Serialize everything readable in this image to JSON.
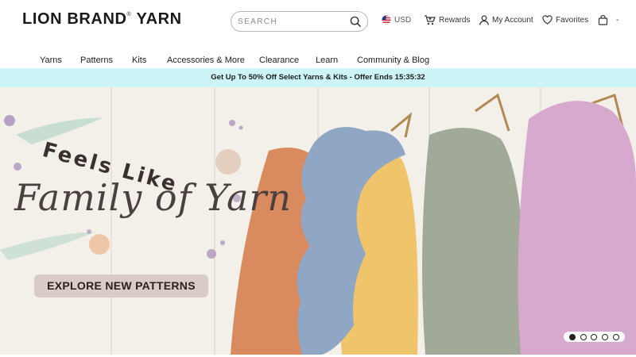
{
  "brand": {
    "name": "LION BRAND",
    "reg": "®",
    "name2": "YARN"
  },
  "search": {
    "placeholder": "SEARCH",
    "icon": "search-icon"
  },
  "utility": {
    "currency": "USD",
    "rewards": "Rewards",
    "account": "My Account",
    "favorites": "Favorites",
    "cart": "-"
  },
  "nav": {
    "items": [
      "Yarns",
      "Patterns",
      "Kits",
      "Accessories & More",
      "Clearance",
      "Learn",
      "Community & Blog"
    ]
  },
  "promo": {
    "text": "Get Up To 50% Off Select Yarns & Kits - Offer Ends 15:35:32"
  },
  "hero": {
    "headline": "Feels Like",
    "script": "Family of Yarn",
    "cta": "EXPLORE NEW PATTERNS",
    "slides_total": 5,
    "slide_active": 1
  },
  "colors": {
    "promo_bg": "#cdf4f6",
    "cta_bg": "#d9cbc5",
    "sweater_orange": "#d98a5e",
    "sweater_blue": "#8fa6c4",
    "sweater_yellow": "#f0c46a",
    "sweater_green": "#a1aa98",
    "sweater_pink": "#d8a9cf"
  }
}
